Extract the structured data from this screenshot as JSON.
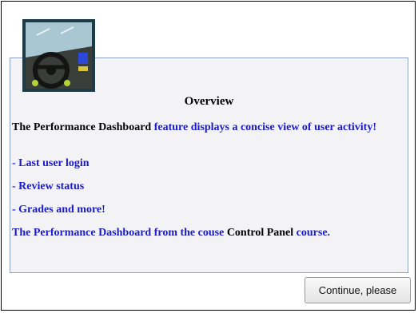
{
  "overview": {
    "title": "Overview",
    "intro": {
      "part1": "The Performance Dashboard",
      "part2": " feature displays a concise view of user activity!"
    },
    "bullets": [
      "- Last user login",
      "- Review status",
      "- Grades and more!"
    ],
    "footer": {
      "part1": "The Performance Dashboard from the couse ",
      "part2": "Control Panel",
      "part3": " course."
    }
  },
  "buttons": {
    "continue_label": "Continue, please"
  },
  "colors": {
    "text_blue": "#1a1acc",
    "panel_bg": "#f3f3f6",
    "panel_border": "#8fa3c8"
  },
  "icons": {
    "thumbnail": "car-dashboard-icon"
  }
}
